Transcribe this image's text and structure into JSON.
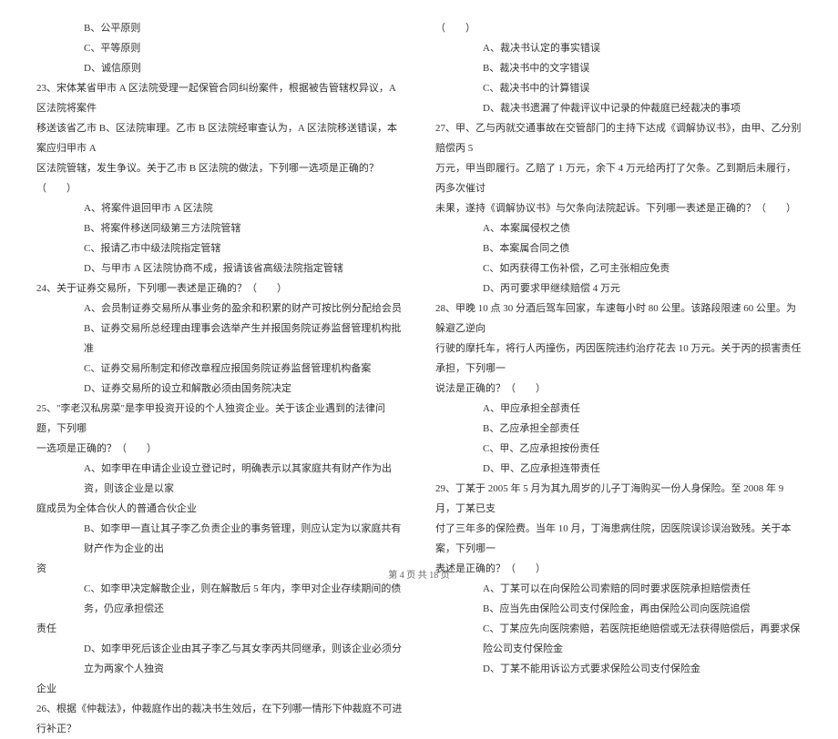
{
  "left_column": {
    "opts_top": [
      "B、公平原则",
      "C、平等原则",
      "D、诚信原则"
    ],
    "q23": {
      "line1": "23、宋体某省甲市 A 区法院受理一起保管合同纠纷案件，根据被告管辖权异议，A 区法院将案件",
      "line2": "移送该省乙市 B、区法院审理。乙市 B 区法院经审查认为，A 区法院移送错误，本案应归甲市 A",
      "line3": "区法院管辖，发生争议。关于乙市 B 区法院的做法，下列哪一选项是正确的？（　　）",
      "opts": [
        "A、将案件退回甲市 A 区法院",
        "B、将案件移送同级第三方法院管辖",
        "C、报请乙市中级法院指定管辖",
        "D、与甲市 A 区法院协商不成，报请该省高级法院指定管辖"
      ]
    },
    "q24": {
      "line1": "24、关于证券交易所，下列哪一表述是正确的？（　　）",
      "opts": [
        "A、会员制证券交易所从事业务的盈余和积累的财产可按比例分配给会员",
        "B、证券交易所总经理由理事会选举产生并报国务院证券监督管理机构批准",
        "C、证券交易所制定和修改章程应报国务院证券监督管理机构备案",
        "D、证券交易所的设立和解散必须由国务院决定"
      ]
    },
    "q25": {
      "line1": "25、\"李老汉私房菜\"是李甲投资开设的个人独资企业。关于该企业遇到的法律问题，下列哪",
      "line2": "一选项是正确的？（　　）",
      "optA": {
        "l1": "A、如李甲在申请企业设立登记时，明确表示以其家庭共有财产作为出资，则该企业是以家",
        "l2": "庭成员为全体合伙人的普通合伙企业"
      },
      "optB": {
        "l1": "B、如李甲一直让其子李乙负责企业的事务管理，则应认定为以家庭共有财产作为企业的出",
        "l2": "资"
      },
      "optC": {
        "l1": "C、如李甲决定解散企业，则在解散后 5 年内，李甲对企业存续期间的债务，仍应承担偿还",
        "l2": "责任"
      },
      "optD": {
        "l1": "D、如李甲死后该企业由其子李乙与其女李丙共同继承，则该企业必须分立为两家个人独资",
        "l2": "企业"
      }
    },
    "q26": {
      "line1": "26、根据《仲裁法》，仲裁庭作出的裁决书生效后，在下列哪一情形下仲裁庭不可进行补正？"
    }
  },
  "right_column": {
    "cont_top": "（　　）",
    "opts_top": [
      "A、裁决书认定的事实错误",
      "B、裁决书中的文字错误",
      "C、裁决书中的计算错误",
      "D、裁决书遗漏了仲裁评议中记录的仲裁庭已经裁决的事项"
    ],
    "q27": {
      "line1": "27、甲、乙与丙就交通事故在交管部门的主持下达成《调解协议书》，由甲、乙分别赔偿丙 5",
      "line2": "万元，甲当即履行。乙赔了 1 万元，余下 4 万元给丙打了欠条。乙到期后未履行，丙多次催讨",
      "line3": "未果，遂持《调解协议书》与欠条向法院起诉。下列哪一表述是正确的？（　　）",
      "opts": [
        "A、本案属侵权之债",
        "B、本案属合同之债",
        "C、如丙获得工伤补偿，乙可主张相应免责",
        "D、丙可要求甲继续赔偿 4 万元"
      ]
    },
    "q28": {
      "line1": "28、甲晚 10 点 30 分酒后驾车回家，车速每小时 80 公里。该路段限速 60 公里。为躲避乙逆向",
      "line2": "行驶的摩托车，将行人丙撞伤，丙因医院违约治疗花去 10 万元。关于丙的损害责任承担，下列哪一",
      "line3": "说法是正确的？（　　）",
      "opts": [
        "A、甲应承担全部责任",
        "B、乙应承担全部责任",
        "C、甲、乙应承担按份责任",
        "D、甲、乙应承担连带责任"
      ]
    },
    "q29": {
      "line1": "29、丁某于 2005 年 5 月为其九周岁的儿子丁海购买一份人身保险。至 2008 年 9 月，丁某已支",
      "line2": "付了三年多的保险费。当年 10 月，丁海患病住院，因医院误诊误治致残。关于本案，下列哪一",
      "line3": "表述是正确的？（　　）",
      "opts": [
        "A、丁某可以在向保险公司索赔的同时要求医院承担赔偿责任",
        "B、应当先由保险公司支付保险金，再由保险公司向医院追偿",
        "C、丁某应先向医院索赔，若医院拒绝赔偿或无法获得赔偿后，再要求保险公司支付保险金",
        "D、丁某不能用诉讼方式要求保险公司支付保险金"
      ]
    }
  },
  "footer": "第 4 页 共 18 页"
}
